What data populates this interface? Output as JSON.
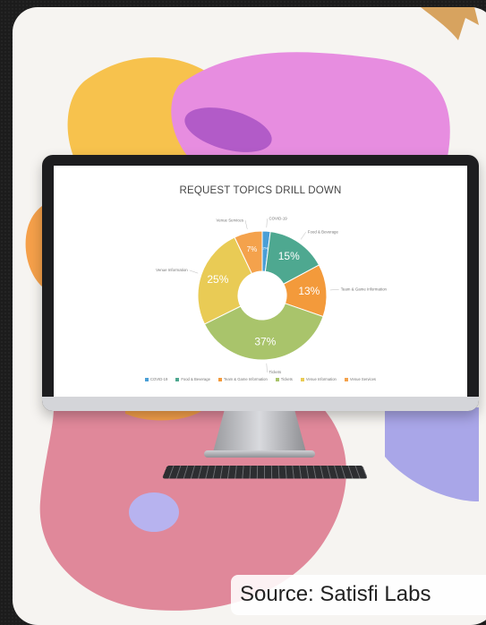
{
  "page": {
    "source": "Source: Satisfi Labs"
  },
  "colors": {
    "background": "#1c1c1c",
    "card": "#f6f4f1",
    "blob_yellow": "#f7c24d",
    "blob_purple": "#c36fdc",
    "blob_pink": "#e48a9a",
    "blob_orange": "#f5a04a",
    "blob_blue": "#b7b3ef",
    "arrow": "#d7a35f"
  },
  "chart_data": {
    "type": "pie",
    "donut": true,
    "title": "REQUEST TOPICS DRILL DOWN",
    "slices": [
      {
        "name": "COVID-19",
        "value": 2,
        "label": "2%",
        "color": "#4a9fd6"
      },
      {
        "name": "Food & Beverage",
        "value": 15,
        "label": "15%",
        "color": "#4ea890"
      },
      {
        "name": "Team & Game Information",
        "value": 13,
        "label": "13%",
        "color": "#f39a3b"
      },
      {
        "name": "Tickets",
        "value": 37,
        "label": "37%",
        "color": "#a9c46b"
      },
      {
        "name": "Venue Information",
        "value": 25,
        "label": "25%",
        "color": "#e9cb55"
      },
      {
        "name": "Venue Services",
        "value": 7,
        "label": "7%",
        "color": "#f4a24c"
      }
    ],
    "legend_placement": "bottom"
  }
}
